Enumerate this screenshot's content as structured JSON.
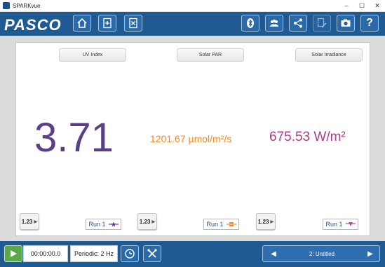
{
  "window": {
    "title": "SPARKvue",
    "minimize": "–",
    "maximize": "☐",
    "close": "✕"
  },
  "toolbar": {
    "logo": "PASCO",
    "buttons": [
      "home-icon",
      "new-file-icon",
      "close-file-icon",
      "bluetooth-icon",
      "users-icon",
      "share-icon",
      "edit-icon",
      "camera-icon",
      "help-icon"
    ],
    "help_label": "?"
  },
  "meters": [
    {
      "title": "UV Index",
      "value": "3.71",
      "color": "#5b3d8a"
    },
    {
      "title": "Solar PAR",
      "value": "1201.67 µmol/m²/s",
      "color": "#f08a2a"
    },
    {
      "title": "Solar Irradiance",
      "value": "675.53 W/m²",
      "color": "#b03a8e"
    }
  ],
  "controls": {
    "num_label": "1.23",
    "run_label": "Run 1",
    "run_colors": [
      "#6a3c96",
      "#f08a2a",
      "#c040a0"
    ]
  },
  "bottombar": {
    "timer": "00:00:00.0",
    "periodic": "Periodic: 2 Hz",
    "page_label": "2: Untitled",
    "prev": "◀",
    "next": "▶"
  },
  "colors": {
    "accent": "#1f5a93",
    "play": "#5aa84a"
  }
}
